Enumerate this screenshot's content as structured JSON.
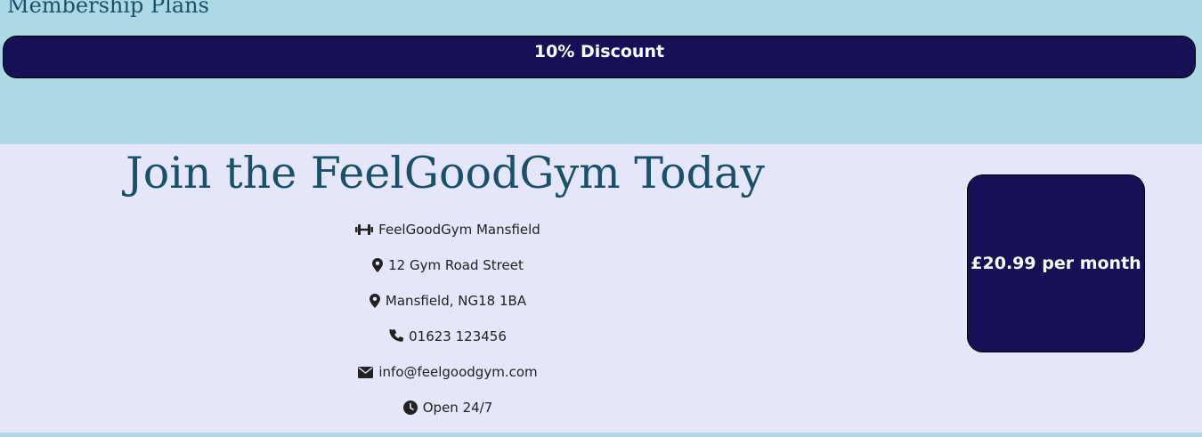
{
  "membership": {
    "title": "Membership Plans",
    "discount_label": "10% Discount"
  },
  "join": {
    "title": "Join the FeelGoodGym Today",
    "contact": [
      {
        "icon": "dumbbell-icon",
        "text": "FeelGoodGym Mansfield"
      },
      {
        "icon": "map-pin-icon",
        "text": "12 Gym Road Street"
      },
      {
        "icon": "map-pin-icon",
        "text": "Mansfield, NG18 1BA"
      },
      {
        "icon": "phone-icon",
        "text": "01623 123456"
      },
      {
        "icon": "envelope-icon",
        "text": "info@feelgoodgym.com"
      },
      {
        "icon": "clock-icon",
        "text": "Open 24/7"
      }
    ],
    "price": "£20.99 per month"
  },
  "colors": {
    "background": "#add8e6",
    "panel": "#e6e6fa",
    "accent": "#161157",
    "heading": "#1a5068"
  }
}
